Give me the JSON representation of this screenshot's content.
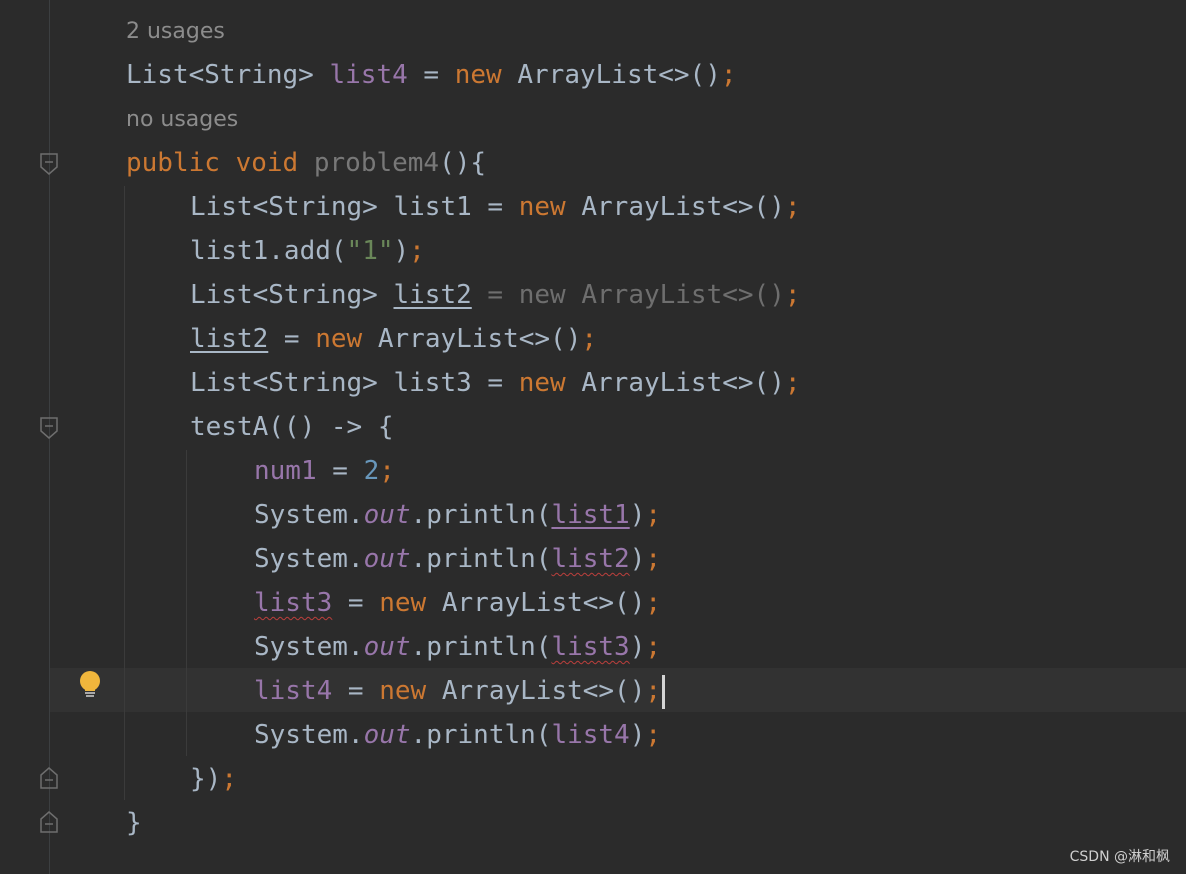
{
  "editor": {
    "hints": {
      "usages_list4": "2 usages",
      "no_usages": "no usages"
    },
    "line1": {
      "type": "List<String> ",
      "var": "list4",
      "rest": " = ",
      "kw_new": "new",
      "ctor": " ArrayList<>()",
      "semi": ";"
    },
    "line2": {
      "kw1": "public",
      "space": " ",
      "kw2": "void",
      "method": " problem4",
      "rest": "(){"
    },
    "line3": {
      "type": "List<String> list1 = ",
      "kw_new": "new",
      "ctor": " ArrayList<>()",
      "semi": ";"
    },
    "line4": {
      "a": "list1.add(",
      "str": "\"1\"",
      "b": ")",
      "semi": ";"
    },
    "line5": {
      "type": "List<String> ",
      "var": "list2",
      "rest": " = new ArrayList<>()",
      "semi": ";"
    },
    "line6": {
      "var": "list2",
      "rest": " = ",
      "kw_new": "new",
      "ctor": " ArrayList<>()",
      "semi": ";"
    },
    "line7": {
      "type": "List<String> list3 = ",
      "kw_new": "new",
      "ctor": " ArrayList<>()",
      "semi": ";"
    },
    "line8": {
      "text": "testA(() -> {"
    },
    "line9": {
      "var": "num1",
      "rest": " = ",
      "num": "2",
      "semi": ";"
    },
    "line10": {
      "a": "System.",
      "field": "out",
      "b": ".println(",
      "var": "list1",
      "c": ")",
      "semi": ";"
    },
    "line11": {
      "a": "System.",
      "field": "out",
      "b": ".println(",
      "var": "list2",
      "c": ")",
      "semi": ";"
    },
    "line12": {
      "var": "list3",
      "rest": " = ",
      "kw_new": "new",
      "ctor": " ArrayList<>()",
      "semi": ";"
    },
    "line13": {
      "a": "System.",
      "field": "out",
      "b": ".println(",
      "var": "list3",
      "c": ")",
      "semi": ";"
    },
    "line14": {
      "var": "list4",
      "rest": " = ",
      "kw_new": "new",
      "ctor": " ArrayList<>()",
      "semi": ";"
    },
    "line15": {
      "a": "System.",
      "field": "out",
      "b": ".println(",
      "var": "list4",
      "c": ")",
      "semi": ";"
    },
    "line16": {
      "a": "})",
      "semi": ";"
    },
    "line17": {
      "a": "}"
    }
  },
  "icons": {
    "fold_marker": "fold-marker-icon",
    "bulb": "intention-bulb-icon"
  },
  "colors": {
    "background": "#2b2b2b",
    "keyword": "#cc7832",
    "variable": "#9876aa",
    "string": "#6a8759",
    "number": "#6897bb",
    "default": "#a9b7c6",
    "error_underline": "#bc3f3c",
    "bulb": "#f0b63c"
  },
  "watermark": "CSDN @淋和枫"
}
